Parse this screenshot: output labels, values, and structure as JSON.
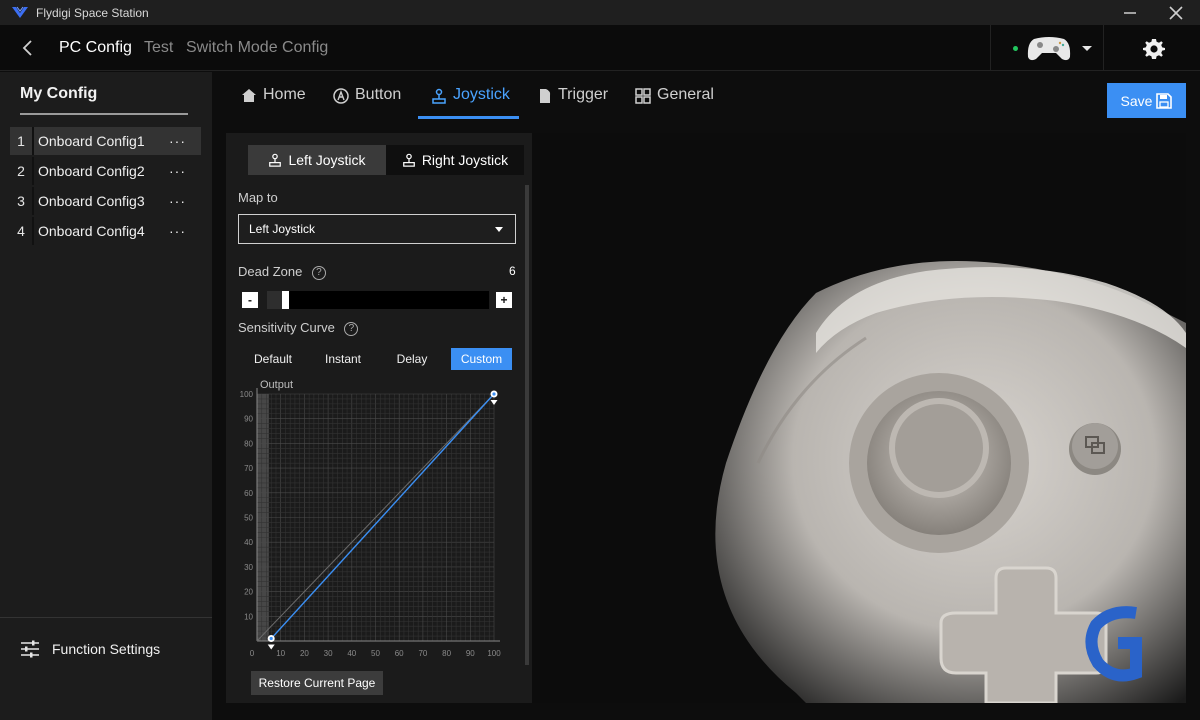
{
  "titlebar": {
    "app_title": "Flydigi Space Station"
  },
  "header": {
    "tabs": [
      {
        "label": "PC Config"
      },
      {
        "label": "Test"
      },
      {
        "label": "Switch Mode Config"
      }
    ],
    "device_status_color": "#22c55e"
  },
  "sidebar": {
    "title": "My Config",
    "items": [
      {
        "num": "1",
        "label": "Onboard Config1",
        "more": "···"
      },
      {
        "num": "2",
        "label": "Onboard Config2",
        "more": "···"
      },
      {
        "num": "3",
        "label": "Onboard Config3",
        "more": "···"
      },
      {
        "num": "4",
        "label": "Onboard Config4",
        "more": "···"
      }
    ],
    "footer_label": "Function Settings"
  },
  "main_tabs": [
    {
      "label": "Home",
      "icon": "home-icon"
    },
    {
      "label": "Button",
      "icon": "a-button-icon"
    },
    {
      "label": "Joystick",
      "icon": "joystick-icon"
    },
    {
      "label": "Trigger",
      "icon": "trigger-icon"
    },
    {
      "label": "General",
      "icon": "general-icon"
    }
  ],
  "save_label": "Save",
  "accent_color": "#3b8ff3",
  "joystick_panel": {
    "stick_tabs": [
      {
        "label": "Left Joystick"
      },
      {
        "label": "Right Joystick"
      }
    ],
    "map_to_label": "Map to",
    "map_to_value": "Left Joystick",
    "dead_zone_label": "Dead Zone",
    "dead_zone_value": "6",
    "dead_zone_fraction": 0.06,
    "minus": "-",
    "plus": "+",
    "sensitivity_label": "Sensitivity Curve",
    "curve_options": [
      {
        "label": "Default"
      },
      {
        "label": "Instant"
      },
      {
        "label": "Delay"
      },
      {
        "label": "Custom"
      }
    ],
    "graph": {
      "y_label": "Output",
      "y_ticks": [
        "100",
        "90",
        "80",
        "70",
        "60",
        "50",
        "40",
        "30",
        "20",
        "10"
      ],
      "x_ticks": [
        "0",
        "10",
        "20",
        "30",
        "40",
        "50",
        "60",
        "70",
        "80",
        "90",
        "100"
      ],
      "curve": [
        [
          6,
          1
        ],
        [
          100,
          100
        ]
      ]
    },
    "restore_label": "Restore Current Page"
  }
}
